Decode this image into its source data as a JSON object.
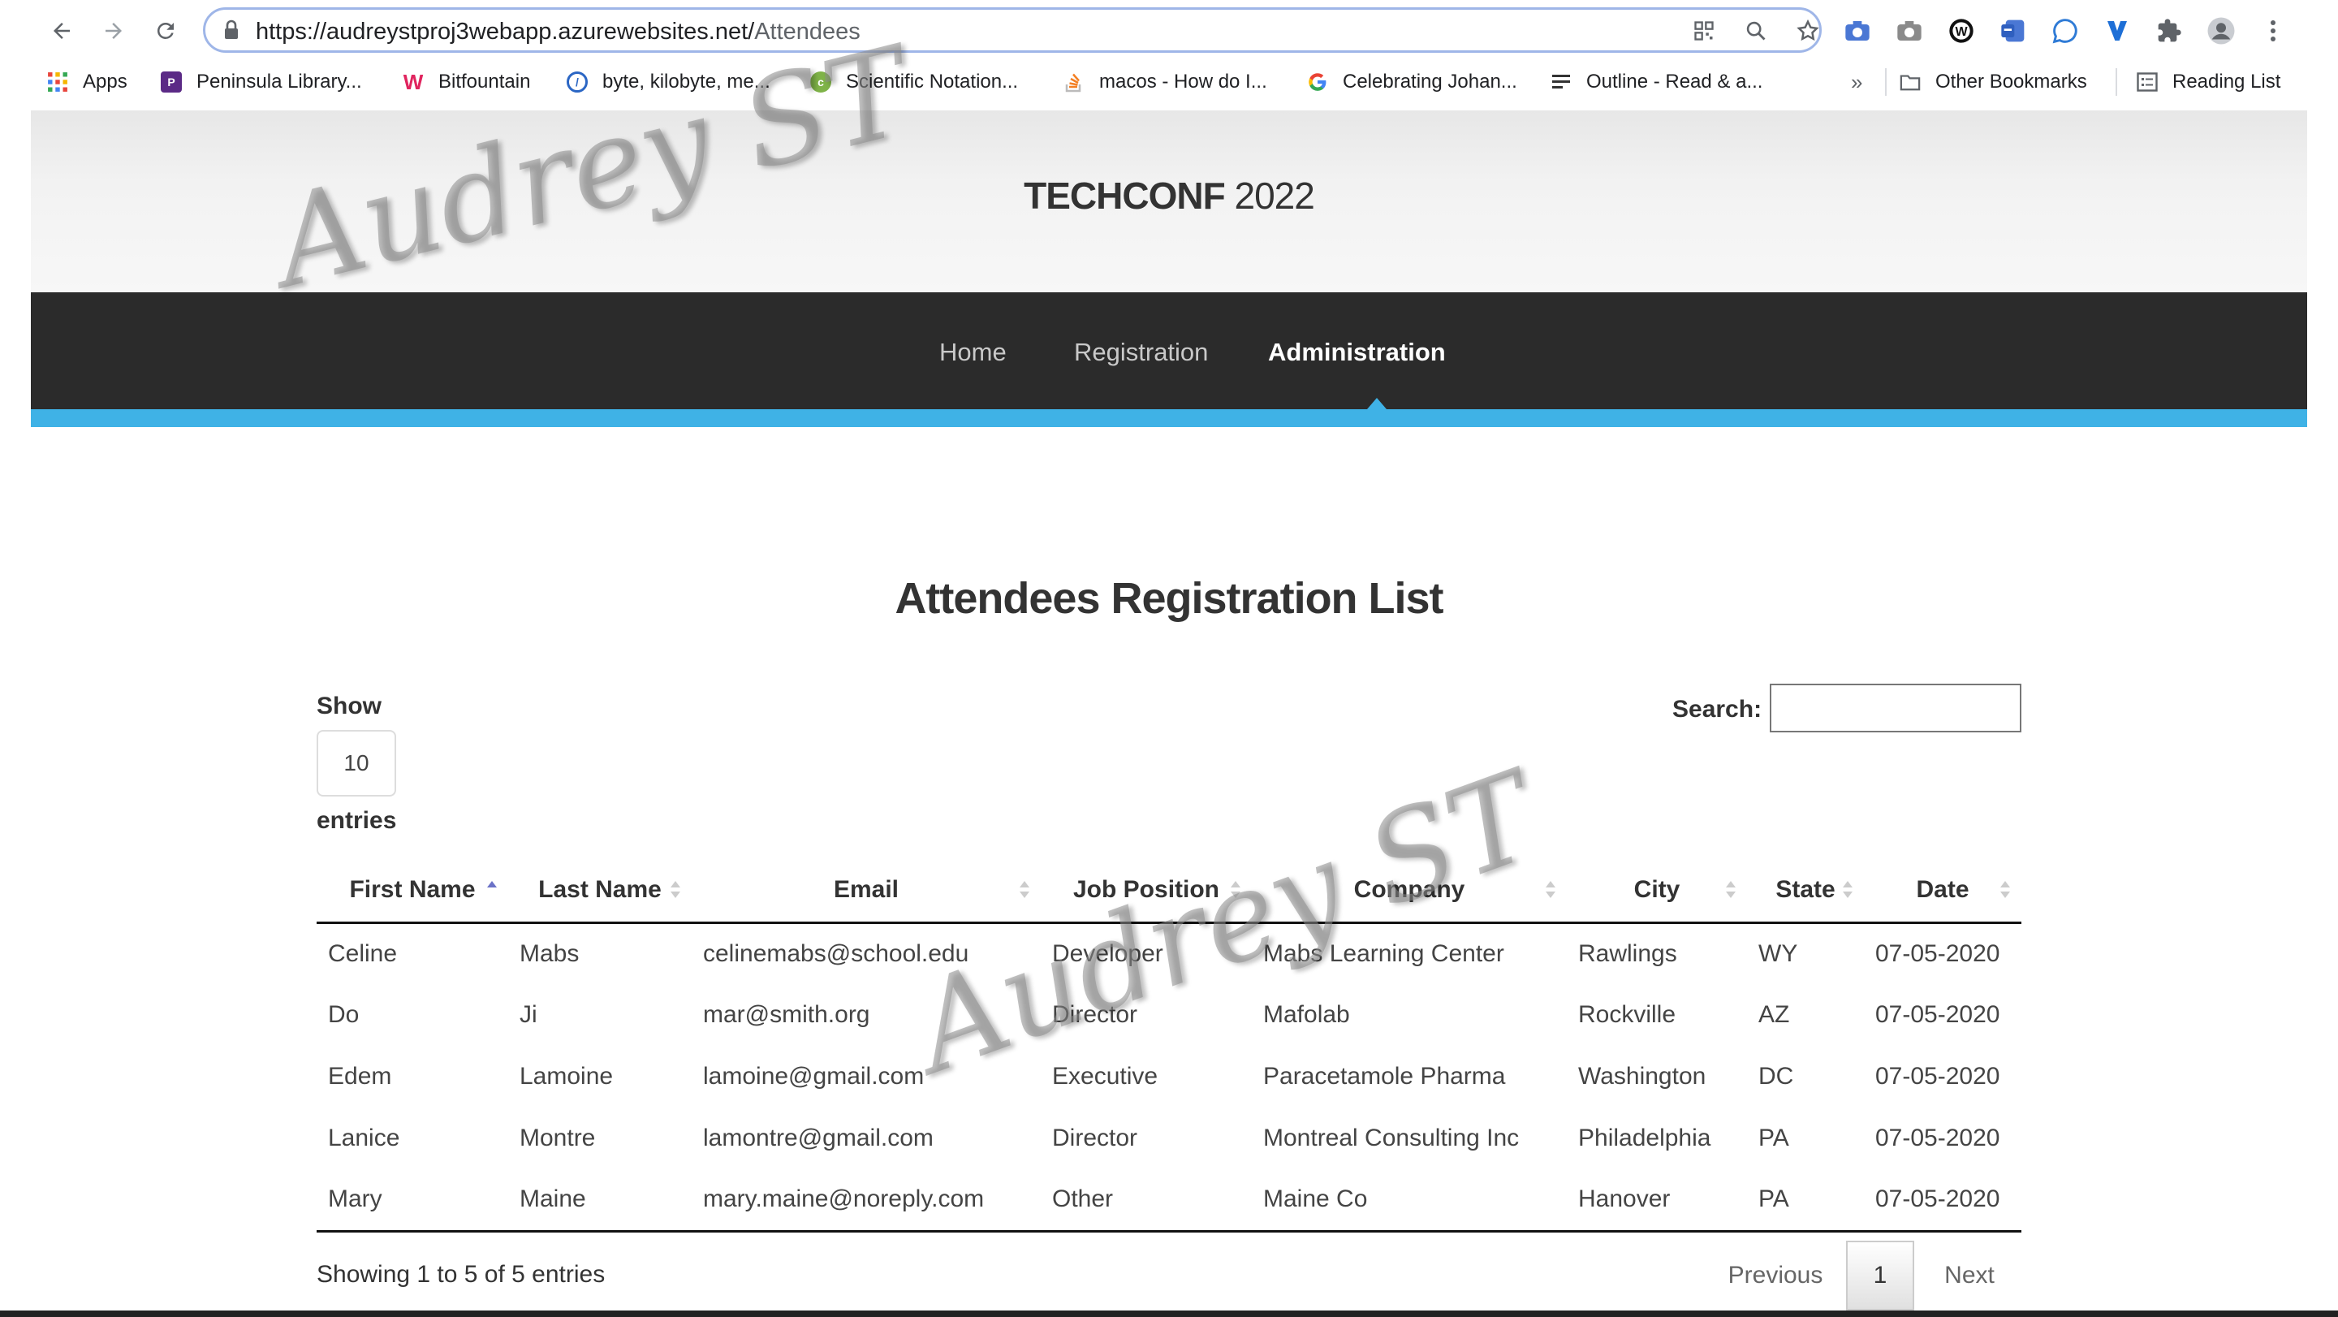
{
  "browser": {
    "url_host": "https://audreystproj3webapp.azurewebsites.net/",
    "url_path": "Attendees",
    "bookmarks": [
      {
        "label": "Apps",
        "icon": "apps-grid-icon"
      },
      {
        "label": "Peninsula Library...",
        "icon": "pls-icon"
      },
      {
        "label": "Bitfountain",
        "icon": "bitfountain-icon"
      },
      {
        "label": "byte, kilobyte, me...",
        "icon": "byte-icon"
      },
      {
        "label": "Scientific Notation...",
        "icon": "calc-icon"
      },
      {
        "label": "macos - How do I...",
        "icon": "stackoverflow-icon"
      },
      {
        "label": "Celebrating Johan...",
        "icon": "google-icon"
      },
      {
        "label": "Outline - Read & a...",
        "icon": "outline-icon"
      },
      {
        "label": "Other Bookmarks",
        "icon": "folder-icon"
      },
      {
        "label": "Reading List",
        "icon": "reading-list-icon"
      }
    ],
    "overflow_label": "»"
  },
  "site": {
    "title_bold": "TECHCONF",
    "title_rest": " 2022",
    "nav": [
      {
        "label": "Home",
        "active": false
      },
      {
        "label": "Registration",
        "active": false
      },
      {
        "label": "Administration",
        "active": true
      }
    ]
  },
  "main": {
    "heading": "Attendees Registration List",
    "show_label": "Show",
    "page_length": "10",
    "entries_label": "entries",
    "search_label": "Search:",
    "search_value": "",
    "columns": [
      "First Name",
      "Last Name",
      "Email",
      "Job Position",
      "Company",
      "City",
      "State",
      "Date"
    ],
    "sorted_column": "First Name",
    "rows": [
      [
        "Celine",
        "Mabs",
        "celinemabs@school.edu",
        "Developer",
        "Mabs Learning Center",
        "Rawlings",
        "WY",
        "07-05-2020"
      ],
      [
        "Do",
        "Ji",
        "mar@smith.org",
        "Director",
        "Mafolab",
        "Rockville",
        "AZ",
        "07-05-2020"
      ],
      [
        "Edem",
        "Lamoine",
        "lamoine@gmail.com",
        "Executive",
        "Paracetamole Pharma",
        "Washington",
        "DC",
        "07-05-2020"
      ],
      [
        "Lanice",
        "Montre",
        "lamontre@gmail.com",
        "Director",
        "Montreal Consulting Inc",
        "Philadelphia",
        "PA",
        "07-05-2020"
      ],
      [
        "Mary",
        "Maine",
        "mary.maine@noreply.com",
        "Other",
        "Maine Co",
        "Hanover",
        "PA",
        "07-05-2020"
      ]
    ],
    "info": "Showing 1 to 5 of 5 entries",
    "pagination": {
      "previous": "Previous",
      "current": "1",
      "next": "Next"
    }
  },
  "watermark": "Audrey ST",
  "colors": {
    "accent": "#3fb2e6",
    "nav_bg": "#2b2b2b"
  }
}
